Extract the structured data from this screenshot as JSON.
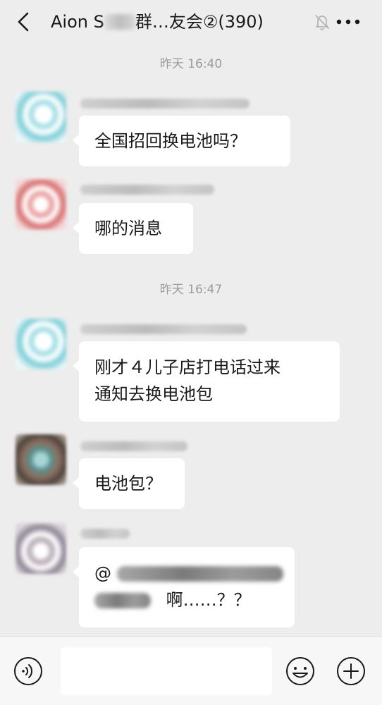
{
  "header": {
    "title_prefix": "Aion S",
    "title_suffix": "群…友会②(390)"
  },
  "timestamps": [
    "昨天 16:40",
    "昨天 16:47"
  ],
  "messages": [
    {
      "lines": [
        "全国招回换电池吗？"
      ]
    },
    {
      "lines": [
        "哪的消息"
      ]
    },
    {
      "lines": [
        "刚才４儿子店打电话过来",
        "通知去换电池包"
      ]
    },
    {
      "lines": [
        "电池包？"
      ]
    },
    {
      "mention": "@",
      "tail": "啊……？？"
    }
  ],
  "input": {
    "placeholder": ""
  },
  "icons": {
    "back": "chevron-left-icon",
    "mute": "bell-off-icon",
    "more": "more-dots-icon",
    "voice": "voice-icon",
    "emoji": "emoji-icon",
    "plus": "plus-icon"
  },
  "colors": {
    "background": "#ededed",
    "bubble": "#ffffff",
    "timestamp": "#9a9a9a",
    "text": "#191919"
  }
}
